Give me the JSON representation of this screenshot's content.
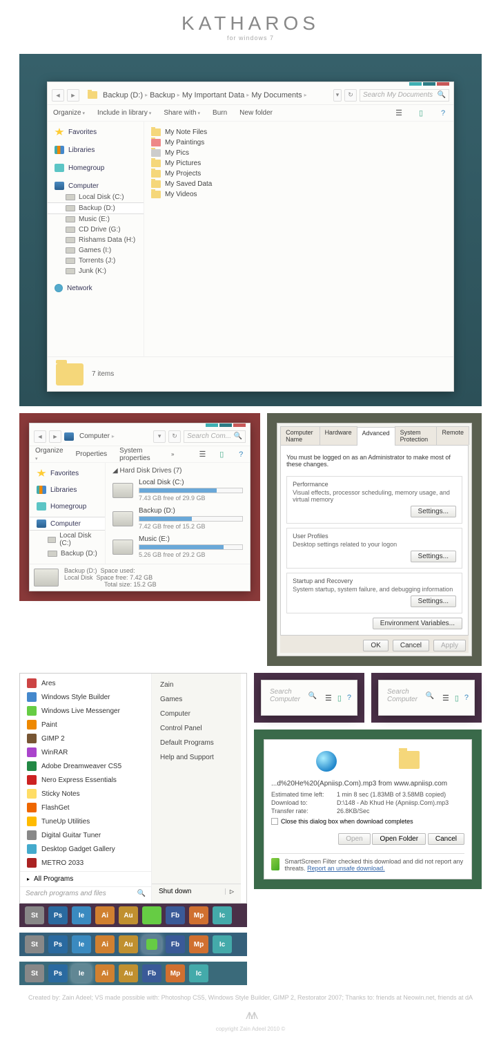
{
  "header": {
    "title": "KATHAROS",
    "subtitle": "for windows 7"
  },
  "explorer": {
    "breadcrumb": [
      "Backup (D:)",
      "Backup",
      "My Important Data",
      "My Documents"
    ],
    "search_placeholder": "Search My Documents",
    "toolbar": {
      "organize": "Organize",
      "include": "Include in library",
      "share": "Share with",
      "burn": "Burn",
      "newfolder": "New folder"
    },
    "nav": {
      "favorites": "Favorites",
      "libraries": "Libraries",
      "homegroup": "Homegroup",
      "computer": "Computer",
      "drives": [
        "Local Disk (C:)",
        "Backup (D:)",
        "Music (E:)",
        "CD Drive (G:)",
        "Rishams Data (H:)",
        "Games (I:)",
        "Torrents (J:)",
        "Junk (K:)"
      ],
      "network": "Network"
    },
    "files": [
      "My Note Files",
      "My Paintings",
      "My Pics",
      "My Pictures",
      "My Projects",
      "My Saved Data",
      "My Videos"
    ],
    "status": "7 items"
  },
  "computer": {
    "breadcrumb": [
      "Computer"
    ],
    "search_placeholder": "Search Com...",
    "toolbar": {
      "organize": "Organize",
      "properties": "Properties",
      "sysprops": "System properties"
    },
    "section": "Hard Disk Drives (7)",
    "drives": [
      {
        "name": "Local Disk (C:)",
        "free": "7.43 GB free of 29.9 GB",
        "pct": 75
      },
      {
        "name": "Backup (D:)",
        "free": "7.42 GB free of 15.2 GB",
        "pct": 51
      },
      {
        "name": "Music (E:)",
        "free": "5.26 GB free of 29.2 GB",
        "pct": 82
      }
    ],
    "status": {
      "name": "Backup (D:)",
      "type": "Local Disk",
      "used_label": "Space used:",
      "free_label": "Space free:",
      "free": "7.42 GB",
      "total_label": "Total size:",
      "total": "15.2 GB"
    }
  },
  "sysdlg": {
    "tabs": [
      "Computer Name",
      "Hardware",
      "Advanced",
      "System Protection",
      "Remote"
    ],
    "active": 2,
    "intro": "You must be logged on as an Administrator to make most of these changes.",
    "sections": [
      {
        "title": "Performance",
        "desc": "Visual effects, processor scheduling, memory usage, and virtual memory",
        "btn": "Settings..."
      },
      {
        "title": "User Profiles",
        "desc": "Desktop settings related to your logon",
        "btn": "Settings..."
      },
      {
        "title": "Startup and Recovery",
        "desc": "System startup, system failure, and debugging information",
        "btn": "Settings..."
      }
    ],
    "envvars": "Environment Variables...",
    "buttons": {
      "ok": "OK",
      "cancel": "Cancel",
      "apply": "Apply"
    }
  },
  "startmenu": {
    "apps": [
      {
        "label": "Ares",
        "color": "#c44"
      },
      {
        "label": "Windows Style Builder",
        "color": "#48c"
      },
      {
        "label": "Windows Live Messenger",
        "color": "#6c4"
      },
      {
        "label": "Paint",
        "color": "#e80"
      },
      {
        "label": "GIMP 2",
        "color": "#753"
      },
      {
        "label": "WinRAR",
        "color": "#a4c"
      },
      {
        "label": "Adobe Dreamweaver CS5",
        "color": "#284"
      },
      {
        "label": "Nero Express Essentials",
        "color": "#c22"
      },
      {
        "label": "Sticky Notes",
        "color": "#fd6"
      },
      {
        "label": "FlashGet",
        "color": "#e60"
      },
      {
        "label": "TuneUp Utilities",
        "color": "#fb0"
      },
      {
        "label": "Digital Guitar Tuner",
        "color": "#888"
      },
      {
        "label": "Desktop Gadget Gallery",
        "color": "#4ac"
      },
      {
        "label": "METRO 2033",
        "color": "#a22"
      }
    ],
    "all_programs": "All Programs",
    "search": "Search programs and files",
    "right": [
      "Zain",
      "Games",
      "Computer",
      "Control Panel",
      "Default Programs",
      "Help and Support"
    ],
    "shutdown": "Shut down"
  },
  "taskbars": [
    {
      "bg": "#4a3048",
      "items": [
        {
          "t": "St",
          "c": "#888"
        },
        {
          "t": "Ps",
          "c": "#2a6aa0"
        },
        {
          "t": "Ie",
          "c": "#3a8ac0"
        },
        {
          "t": "Ai",
          "c": "#d08030"
        },
        {
          "t": "Au",
          "c": "#c09030"
        },
        {
          "t": "",
          "c": "#6c4"
        },
        {
          "t": "Fb",
          "c": "#3a5a98"
        },
        {
          "t": "Mp",
          "c": "#d07030"
        },
        {
          "t": "Ic",
          "c": "#4aa"
        }
      ]
    },
    {
      "bg": "#35607a",
      "items": [
        {
          "t": "St",
          "c": "#888"
        },
        {
          "t": "Ps",
          "c": "#2a6aa0"
        },
        {
          "t": "Ie",
          "c": "#3a8ac0"
        },
        {
          "t": "Ai",
          "c": "#d08030"
        },
        {
          "t": "Au",
          "c": "#c09030"
        },
        {
          "t": "",
          "c": "#6c4",
          "glow": true
        },
        {
          "t": "Fb",
          "c": "#3a5a98"
        },
        {
          "t": "Mp",
          "c": "#d07030"
        },
        {
          "t": "Ic",
          "c": "#4aa"
        }
      ]
    },
    {
      "bg": "#3a6a7a",
      "items": [
        {
          "t": "St",
          "c": "#888"
        },
        {
          "t": "Ps",
          "c": "#2a6aa0"
        },
        {
          "t": "Ie",
          "c": "#3a8ac0",
          "glow": true
        },
        {
          "t": "Ai",
          "c": "#d08030"
        },
        {
          "t": "Au",
          "c": "#c09030"
        },
        {
          "t": "Fb",
          "c": "#3a5a98"
        },
        {
          "t": "Mp",
          "c": "#d07030"
        },
        {
          "t": "Ic",
          "c": "#4aa"
        }
      ]
    }
  ],
  "mini_search": "Search Computer",
  "download": {
    "title": "...d%20He%20(Apniisp.Com).mp3 from www.apniisp.com",
    "rows": [
      {
        "k": "Estimated time left:",
        "v": "1 min 8 sec (1.83MB of 3.58MB copied)"
      },
      {
        "k": "Download to:",
        "v": "D:\\148 - Ab Khud He (Apniisp.Com).mp3"
      },
      {
        "k": "Transfer rate:",
        "v": "26.8KB/Sec"
      }
    ],
    "checkbox": "Close this dialog box when download completes",
    "buttons": {
      "open": "Open",
      "openfolder": "Open Folder",
      "cancel": "Cancel"
    },
    "ssf": "SmartScreen Filter checked this download and did not report any threats.",
    "ssf_link": "Report an unsafe download."
  },
  "footer": {
    "credits": "Created by: Zain Adeel; VS made possible with: Photoshop CS5, Windows Style Builder, GIMP 2, Restorator 2007; Thanks to: friends at Neowin.net, friends at dA",
    "copy": "copyright Zain Adeel 2010 ©"
  }
}
